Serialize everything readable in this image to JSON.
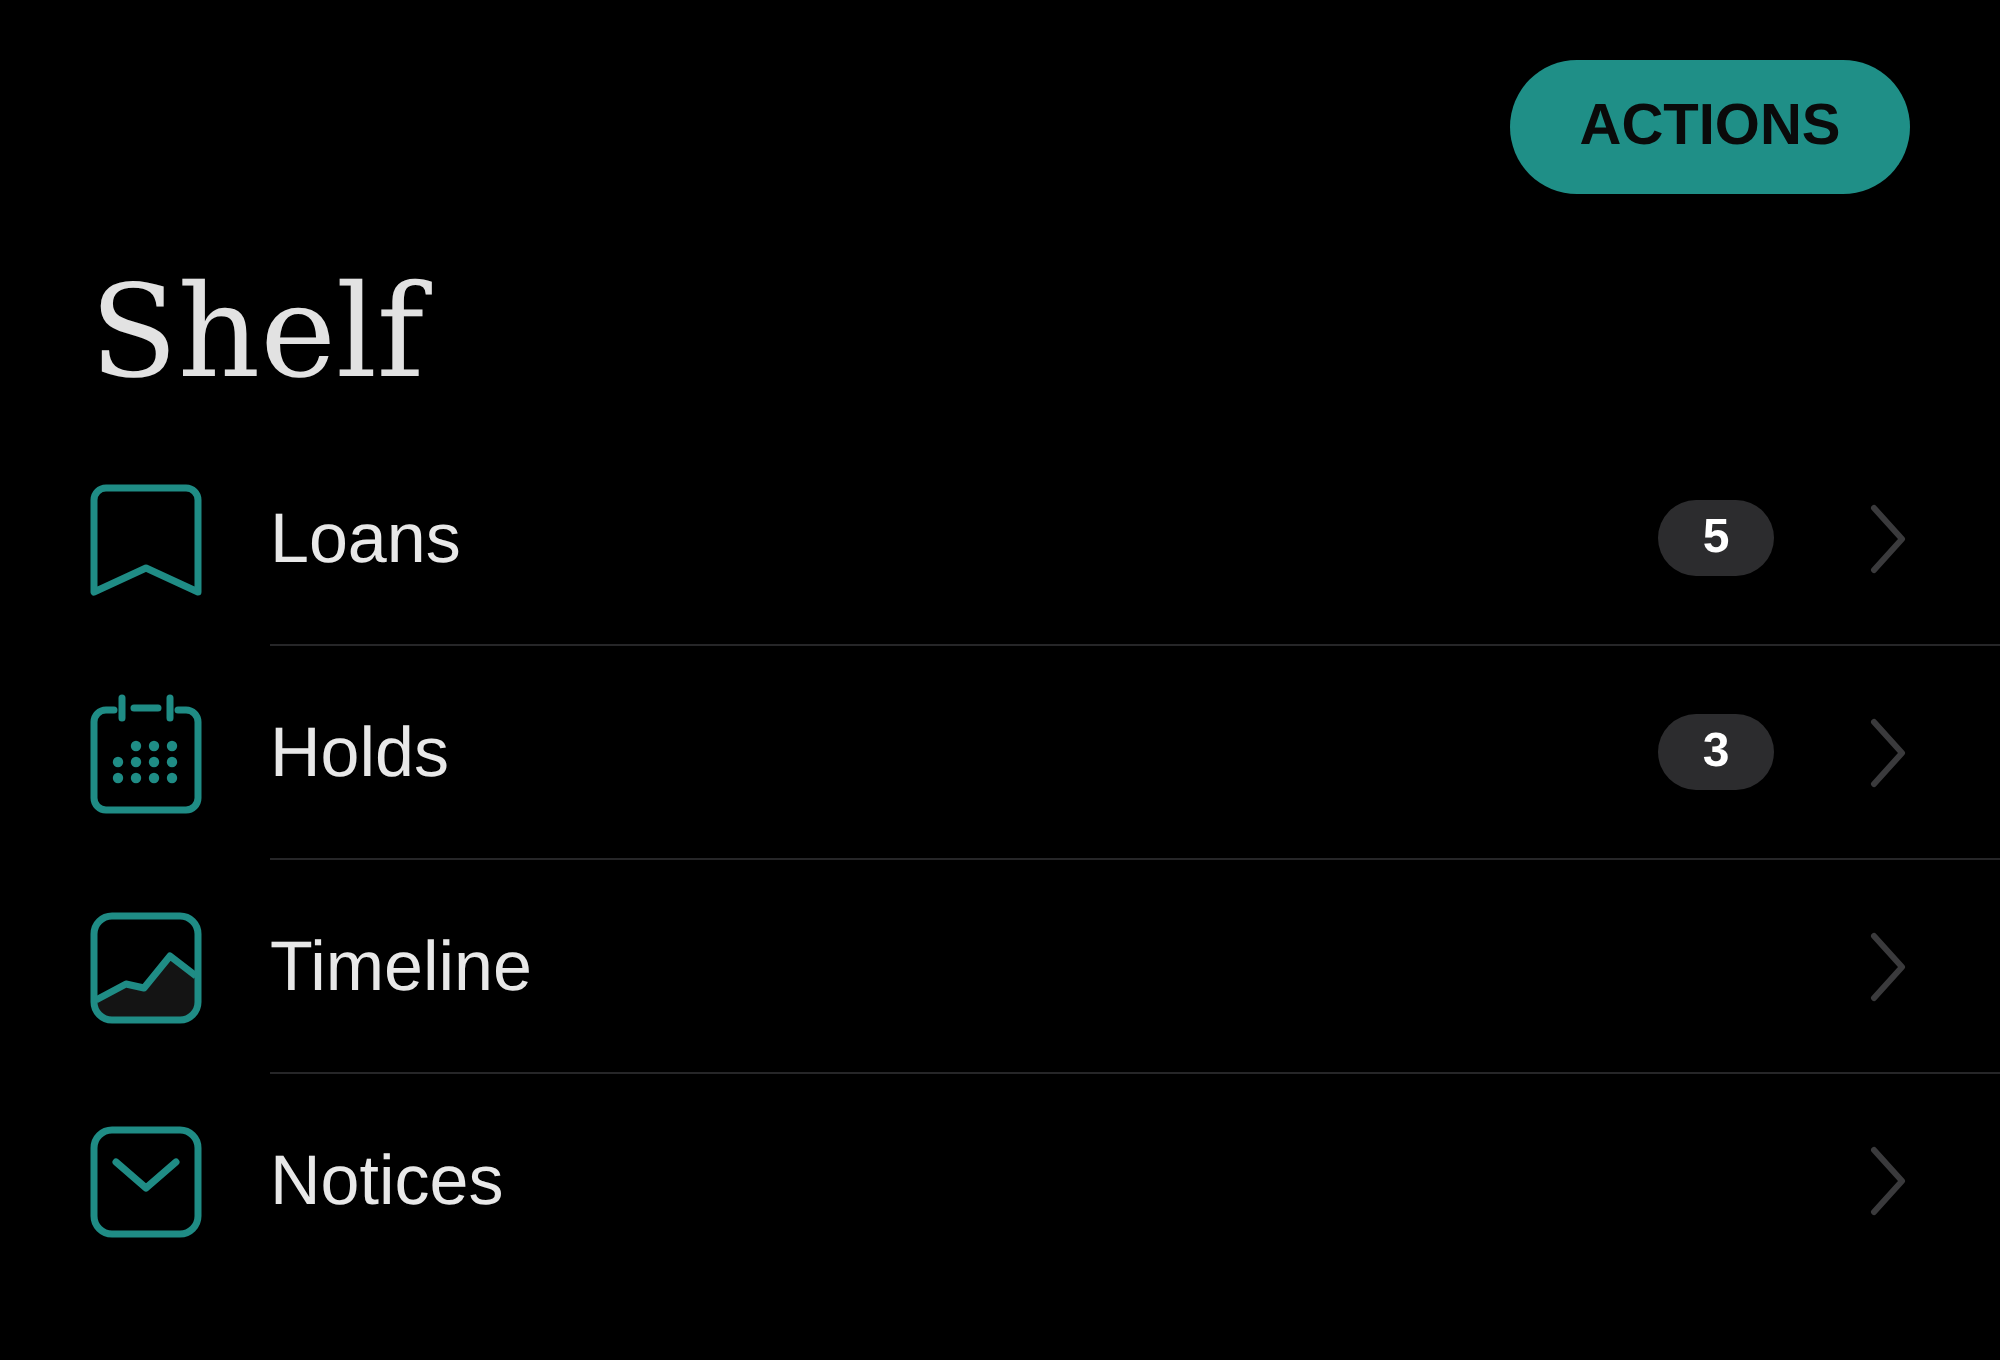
{
  "header": {
    "actions_button": "ACTIONS"
  },
  "title": "Shelf",
  "items": [
    {
      "label": "Loans",
      "badge": "5"
    },
    {
      "label": "Holds",
      "badge": "3"
    },
    {
      "label": "Timeline"
    },
    {
      "label": "Notices"
    }
  ]
}
